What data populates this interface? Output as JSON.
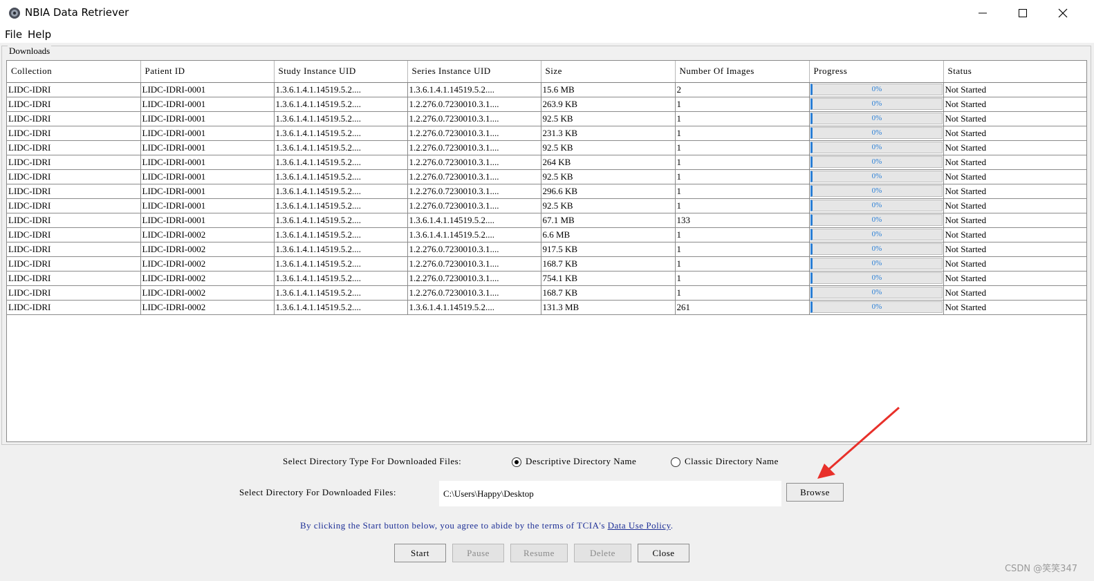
{
  "window": {
    "title": "NBIA Data Retriever",
    "minimize": "—",
    "maximize": "☐",
    "close": "✕"
  },
  "menu": {
    "file": "File",
    "help": "Help"
  },
  "downloads": {
    "group_label": "Downloads",
    "columns": [
      "Collection",
      "Patient ID",
      "Study Instance UID",
      "Series Instance UID",
      "Size",
      "Number Of Images",
      "Progress",
      "Status"
    ],
    "rows": [
      [
        "LIDC-IDRI",
        "LIDC-IDRI-0001",
        "1.3.6.1.4.1.14519.5.2....",
        "1.3.6.1.4.1.14519.5.2....",
        "15.6 MB",
        "2",
        "0%",
        "Not Started"
      ],
      [
        "LIDC-IDRI",
        "LIDC-IDRI-0001",
        "1.3.6.1.4.1.14519.5.2....",
        "1.2.276.0.7230010.3.1....",
        "263.9 KB",
        "1",
        "0%",
        "Not Started"
      ],
      [
        "LIDC-IDRI",
        "LIDC-IDRI-0001",
        "1.3.6.1.4.1.14519.5.2....",
        "1.2.276.0.7230010.3.1....",
        "92.5 KB",
        "1",
        "0%",
        "Not Started"
      ],
      [
        "LIDC-IDRI",
        "LIDC-IDRI-0001",
        "1.3.6.1.4.1.14519.5.2....",
        "1.2.276.0.7230010.3.1....",
        "231.3 KB",
        "1",
        "0%",
        "Not Started"
      ],
      [
        "LIDC-IDRI",
        "LIDC-IDRI-0001",
        "1.3.6.1.4.1.14519.5.2....",
        "1.2.276.0.7230010.3.1....",
        "92.5 KB",
        "1",
        "0%",
        "Not Started"
      ],
      [
        "LIDC-IDRI",
        "LIDC-IDRI-0001",
        "1.3.6.1.4.1.14519.5.2....",
        "1.2.276.0.7230010.3.1....",
        "264 KB",
        "1",
        "0%",
        "Not Started"
      ],
      [
        "LIDC-IDRI",
        "LIDC-IDRI-0001",
        "1.3.6.1.4.1.14519.5.2....",
        "1.2.276.0.7230010.3.1....",
        "92.5 KB",
        "1",
        "0%",
        "Not Started"
      ],
      [
        "LIDC-IDRI",
        "LIDC-IDRI-0001",
        "1.3.6.1.4.1.14519.5.2....",
        "1.2.276.0.7230010.3.1....",
        "296.6 KB",
        "1",
        "0%",
        "Not Started"
      ],
      [
        "LIDC-IDRI",
        "LIDC-IDRI-0001",
        "1.3.6.1.4.1.14519.5.2....",
        "1.2.276.0.7230010.3.1....",
        "92.5 KB",
        "1",
        "0%",
        "Not Started"
      ],
      [
        "LIDC-IDRI",
        "LIDC-IDRI-0001",
        "1.3.6.1.4.1.14519.5.2....",
        "1.3.6.1.4.1.14519.5.2....",
        "67.1 MB",
        "133",
        "0%",
        "Not Started"
      ],
      [
        "LIDC-IDRI",
        "LIDC-IDRI-0002",
        "1.3.6.1.4.1.14519.5.2....",
        "1.3.6.1.4.1.14519.5.2....",
        "6.6 MB",
        "1",
        "0%",
        "Not Started"
      ],
      [
        "LIDC-IDRI",
        "LIDC-IDRI-0002",
        "1.3.6.1.4.1.14519.5.2....",
        "1.2.276.0.7230010.3.1....",
        "917.5 KB",
        "1",
        "0%",
        "Not Started"
      ],
      [
        "LIDC-IDRI",
        "LIDC-IDRI-0002",
        "1.3.6.1.4.1.14519.5.2....",
        "1.2.276.0.7230010.3.1....",
        "168.7 KB",
        "1",
        "0%",
        "Not Started"
      ],
      [
        "LIDC-IDRI",
        "LIDC-IDRI-0002",
        "1.3.6.1.4.1.14519.5.2....",
        "1.2.276.0.7230010.3.1....",
        "754.1 KB",
        "1",
        "0%",
        "Not Started"
      ],
      [
        "LIDC-IDRI",
        "LIDC-IDRI-0002",
        "1.3.6.1.4.1.14519.5.2....",
        "1.2.276.0.7230010.3.1....",
        "168.7 KB",
        "1",
        "0%",
        "Not Started"
      ],
      [
        "LIDC-IDRI",
        "LIDC-IDRI-0002",
        "1.3.6.1.4.1.14519.5.2....",
        "1.3.6.1.4.1.14519.5.2....",
        "131.3 MB",
        "261",
        "0%",
        "Not Started"
      ]
    ]
  },
  "directory_type": {
    "label": "Select Directory Type For Downloaded Files:",
    "options": [
      {
        "label": "Descriptive Directory Name",
        "selected": true
      },
      {
        "label": "Classic Directory Name",
        "selected": false
      }
    ]
  },
  "directory": {
    "label": "Select Directory For Downloaded Files:",
    "value": "C:\\Users\\Happy\\Desktop",
    "browse_label": "Browse"
  },
  "notice": {
    "text": "By clicking the Start button below, you agree to abide by the terms of TCIA's ",
    "link": "Data Use Policy",
    "end": "."
  },
  "actions": {
    "start": "Start",
    "pause": "Pause",
    "resume": "Resume",
    "delete": "Delete",
    "close": "Close"
  },
  "watermark": "CSDN @笑笑347",
  "colors": {
    "progress_accent": "#2a7fd6",
    "notice_text": "#1c2e96",
    "annotation_arrow": "#e8302a"
  }
}
